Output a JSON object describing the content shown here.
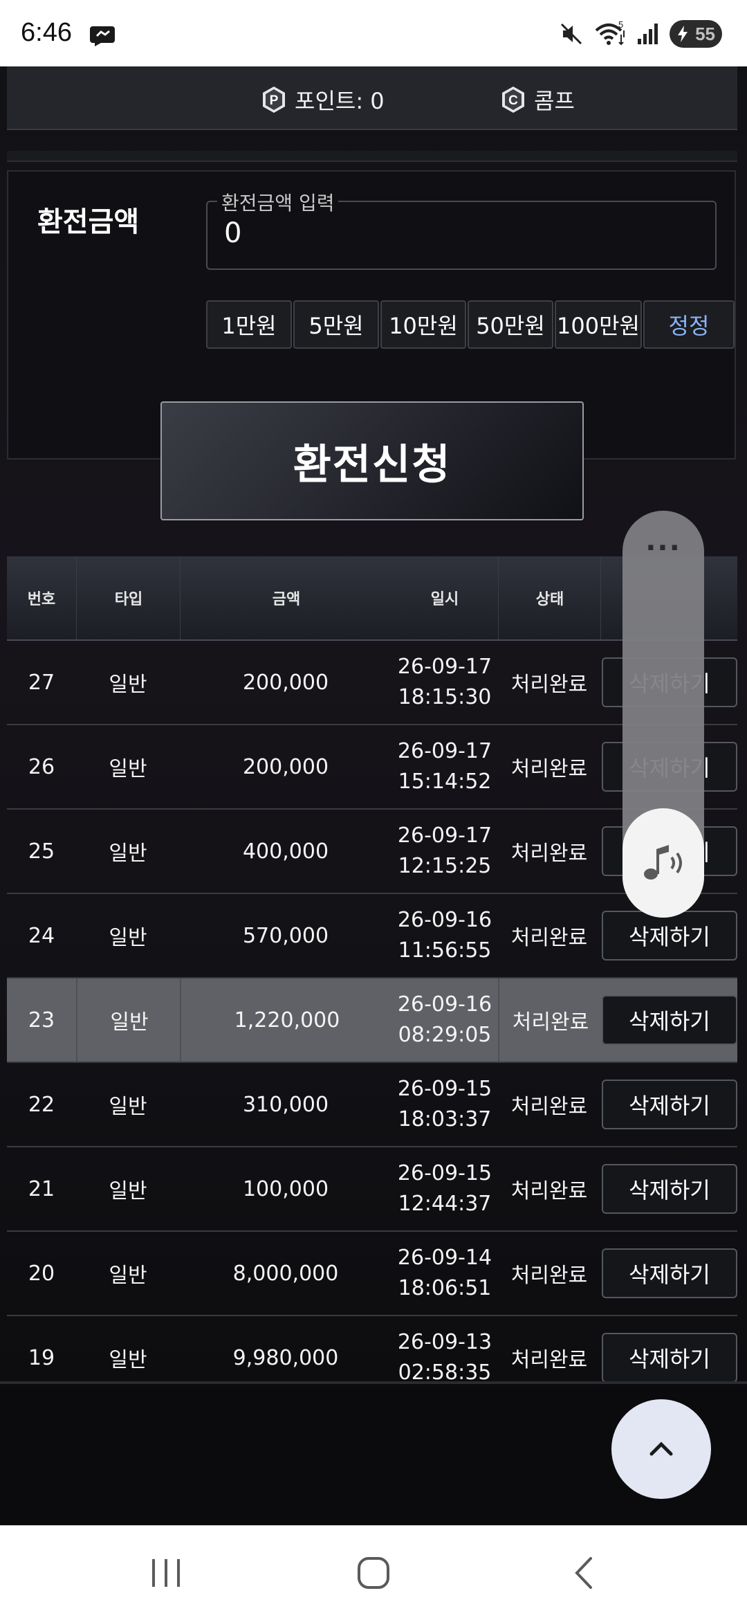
{
  "status_bar": {
    "time": "6:46",
    "battery_level": "55",
    "wifi_badge": "5",
    "icons": [
      "chat-bubble-icon",
      "mute-icon",
      "wifi-icon",
      "signal-icon",
      "battery-charging-icon"
    ]
  },
  "points_bar": {
    "points_label": "포인트: 0",
    "comp_label": "콤프",
    "points_icon_letter": "P",
    "comp_icon_letter": "C"
  },
  "exchange": {
    "label": "환전금액",
    "input_label": "환전금액 입력",
    "input_value": "0",
    "quick_amounts": [
      "1만원",
      "5만원",
      "10만원",
      "50만원",
      "100만원"
    ],
    "reset_label": "정정",
    "submit_label": "환전신청"
  },
  "table": {
    "columns": [
      "번호",
      "타입",
      "금액",
      "일시",
      "상태"
    ],
    "delete_label": "삭제하기",
    "rows": [
      {
        "no": "27",
        "type": "일반",
        "amount": "200,000",
        "date": "26-09-17",
        "time": "18:15:30",
        "status": "처리완료"
      },
      {
        "no": "26",
        "type": "일반",
        "amount": "200,000",
        "date": "26-09-17",
        "time": "15:14:52",
        "status": "처리완료"
      },
      {
        "no": "25",
        "type": "일반",
        "amount": "400,000",
        "date": "26-09-17",
        "time": "12:15:25",
        "status": "처리완료"
      },
      {
        "no": "24",
        "type": "일반",
        "amount": "570,000",
        "date": "26-09-16",
        "time": "11:56:55",
        "status": "처리완료"
      },
      {
        "no": "23",
        "type": "일반",
        "amount": "1,220,000",
        "date": "26-09-16",
        "time": "08:29:05",
        "status": "처리완료"
      },
      {
        "no": "22",
        "type": "일반",
        "amount": "310,000",
        "date": "26-09-15",
        "time": "18:03:37",
        "status": "처리완료"
      },
      {
        "no": "21",
        "type": "일반",
        "amount": "100,000",
        "date": "26-09-15",
        "time": "12:44:37",
        "status": "처리완료"
      },
      {
        "no": "20",
        "type": "일반",
        "amount": "8,000,000",
        "date": "26-09-14",
        "time": "18:06:51",
        "status": "처리완료"
      },
      {
        "no": "19",
        "type": "일반",
        "amount": "9,980,000",
        "date": "26-09-13",
        "time": "02:58:35",
        "status": "처리완료"
      }
    ],
    "highlighted_row": "23"
  },
  "volume_overlay": {
    "more_label": "···",
    "icon": "music-volume-icon"
  },
  "scroll_top": {
    "icon": "chevron-up-icon"
  },
  "nav_bar": {
    "icons": [
      "recent-apps-icon",
      "home-icon",
      "back-icon"
    ]
  },
  "colors": {
    "accent_reset": "#8ab4f8",
    "highlight_row": "#606166",
    "scroll_top_bg": "#e3e6f3"
  }
}
